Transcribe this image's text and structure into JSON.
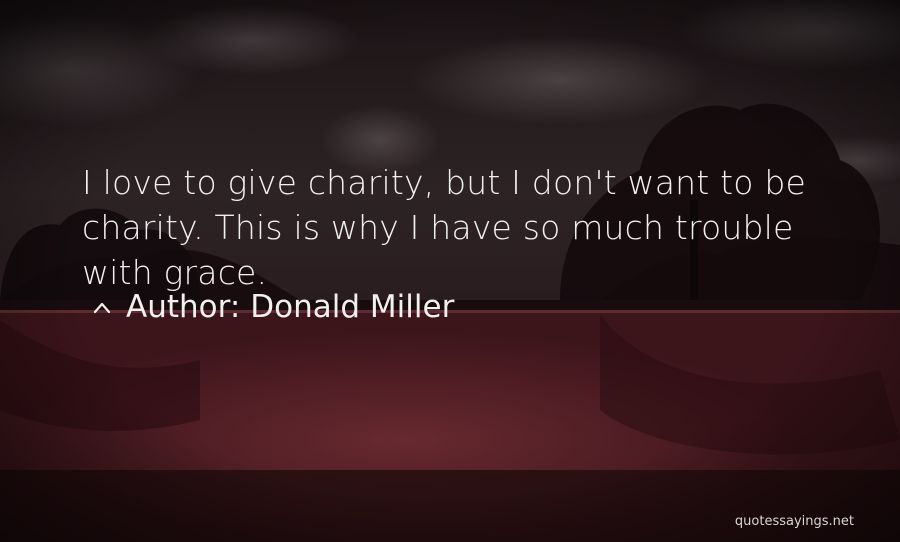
{
  "quote": {
    "text": "I love to give charity, but I don't want to be charity. This is why I have so much trouble with grace."
  },
  "author": {
    "prefix": "Author:",
    "name": "Donald Miller"
  },
  "credit": {
    "site": "quotessayings.net"
  },
  "colors": {
    "text": "#f2efef",
    "sky_dark": "#1c1014",
    "water": "#5a1f26",
    "tree_dark": "#0d0708"
  },
  "icons": {
    "author_marker": "chevron-up-icon"
  }
}
